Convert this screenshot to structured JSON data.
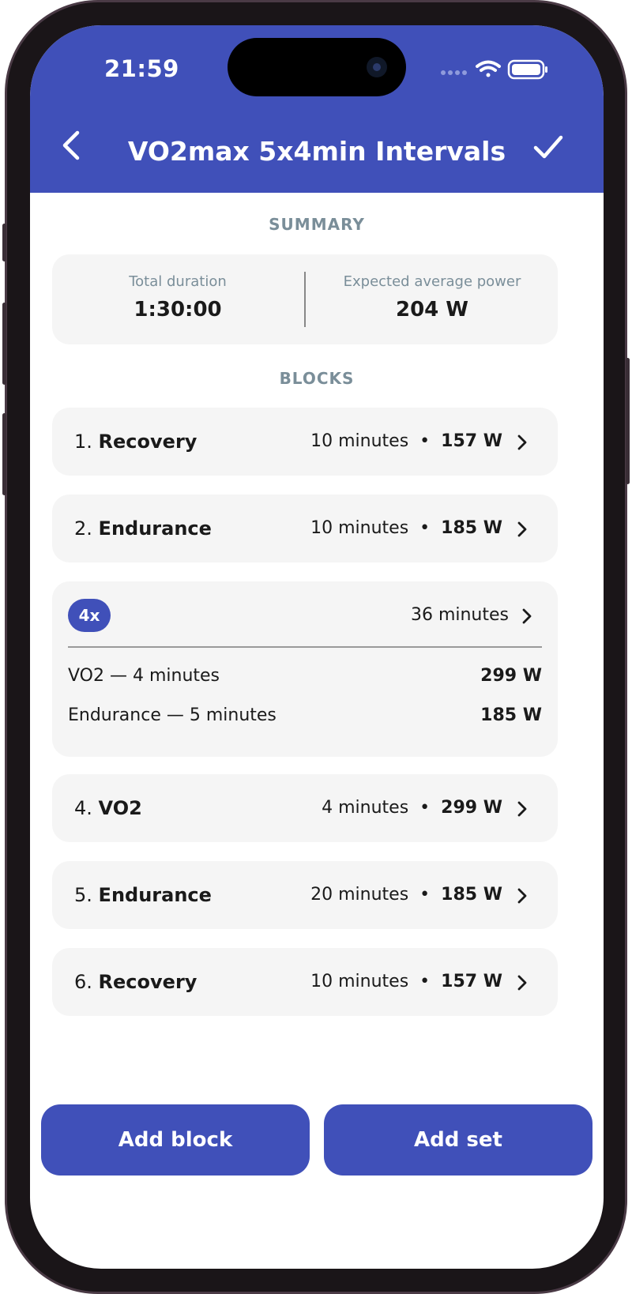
{
  "status_bar": {
    "time": "21:59"
  },
  "header": {
    "title": "VO2max 5x4min Intervals",
    "accent_color": "#4050b9"
  },
  "summary": {
    "section_title": "SUMMARY",
    "total_duration_label": "Total duration",
    "total_duration_value": "1:30:00",
    "avg_power_label": "Expected average power",
    "avg_power_value": "204 W"
  },
  "blocks": {
    "section_title": "BLOCKS",
    "items": [
      {
        "index": "1.",
        "name": "Recovery",
        "duration": "10 minutes",
        "sep": "•",
        "power": "157 W"
      },
      {
        "index": "2.",
        "name": "Endurance",
        "duration": "10 minutes",
        "sep": "•",
        "power": "185 W"
      },
      {
        "index": "4.",
        "name": "VO2",
        "duration": "4 minutes",
        "sep": "•",
        "power": "299 W"
      },
      {
        "index": "5.",
        "name": "Endurance",
        "duration": "20 minutes",
        "sep": "•",
        "power": "185 W"
      },
      {
        "index": "6.",
        "name": "Recovery",
        "duration": "10 minutes",
        "sep": "•",
        "power": "157 W"
      }
    ],
    "set": {
      "repeat": "4x",
      "duration": "36 minutes",
      "rows": [
        {
          "label": "VO2 — 4 minutes",
          "power": "299 W"
        },
        {
          "label": "Endurance — 5 minutes",
          "power": "185 W"
        }
      ]
    }
  },
  "actions": {
    "add_block": "Add block",
    "add_set": "Add set"
  },
  "icons": {
    "back": "chevron-left-icon",
    "confirm": "checkmark-icon",
    "row_chevron": "chevron-right-icon",
    "wifi": "wifi-icon",
    "battery": "battery-icon",
    "signal": "signal-icon"
  }
}
